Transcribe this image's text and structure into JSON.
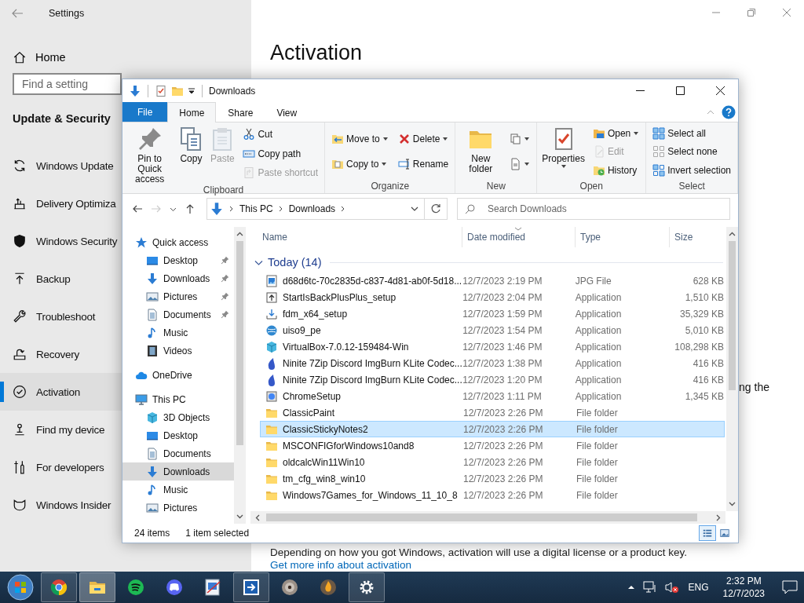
{
  "settings": {
    "title": "Settings",
    "home": "Home",
    "search": {
      "placeholder": "Find a setting"
    },
    "section": "Update & Security",
    "items": [
      {
        "label": "Windows Update",
        "kind": "update",
        "selected": false
      },
      {
        "label": "Delivery Optimiza",
        "kind": "delivery",
        "selected": false
      },
      {
        "label": "Windows Security",
        "kind": "shield",
        "selected": false
      },
      {
        "label": "Backup",
        "kind": "backup",
        "selected": false
      },
      {
        "label": "Troubleshoot",
        "kind": "wrench",
        "selected": false
      },
      {
        "label": "Recovery",
        "kind": "recovery",
        "selected": false
      },
      {
        "label": "Activation",
        "kind": "check",
        "selected": true
      },
      {
        "label": "Find my device",
        "kind": "find",
        "selected": false
      },
      {
        "label": "For developers",
        "kind": "dev",
        "selected": false
      },
      {
        "label": "Windows Insider",
        "kind": "insider",
        "selected": false
      }
    ],
    "page_title": "Activation",
    "fragment": "ng the",
    "description": "Depending on how you got Windows, activation will use a digital license or a product key.",
    "link": "Get more info about activation"
  },
  "explorer": {
    "title": "Downloads",
    "tabs": [
      {
        "label": "File",
        "kind": "menu",
        "selected": false
      },
      {
        "label": "Home",
        "kind": "tab",
        "selected": true
      },
      {
        "label": "Share",
        "kind": "tab",
        "selected": false
      },
      {
        "label": "View",
        "kind": "tab",
        "selected": false
      }
    ],
    "ribbon": [
      {
        "label": "Clipboard",
        "columns": [
          [
            {
              "label": "Pin to Quick access",
              "kind": "pin",
              "disabled": false,
              "dropdown": false
            }
          ],
          [
            {
              "label": "Copy",
              "kind": "copy",
              "disabled": false,
              "dropdown": false
            }
          ],
          [
            {
              "label": "Paste",
              "kind": "paste",
              "disabled": true,
              "dropdown": false
            }
          ],
          [
            {
              "label": "Cut",
              "kind": "cut",
              "disabled": false,
              "dropdown": false
            },
            {
              "label": "Copy path",
              "kind": "copypath",
              "disabled": false,
              "dropdown": false
            },
            {
              "label": "Paste shortcut",
              "kind": "shortcut",
              "disabled": true,
              "dropdown": false
            }
          ]
        ]
      },
      {
        "label": "Organize",
        "columns": [
          [
            {
              "label": "Move to",
              "kind": "move",
              "disabled": false,
              "dropdown": true
            },
            {
              "label": "Copy to",
              "kind": "copyto",
              "disabled": false,
              "dropdown": true
            }
          ],
          [
            {
              "label": "Delete",
              "kind": "delete",
              "disabled": false,
              "dropdown": true
            },
            {
              "label": "Rename",
              "kind": "rename",
              "disabled": false,
              "dropdown": false
            }
          ]
        ]
      },
      {
        "label": "New",
        "columns": [
          [
            {
              "label": "New folder",
              "kind": "folder",
              "disabled": false,
              "dropdown": false
            }
          ],
          [
            {
              "kind": "newitem",
              "disabled": false,
              "dropdown": true
            },
            {
              "kind": "easy",
              "disabled": false,
              "dropdown": true
            }
          ]
        ]
      },
      {
        "label": "Open",
        "columns": [
          [
            {
              "label": "Properties",
              "kind": "doccheck",
              "disabled": false,
              "dropdown": true
            }
          ],
          [
            {
              "label": "Open",
              "kind": "open",
              "disabled": false,
              "dropdown": true
            },
            {
              "label": "Edit",
              "kind": "edit",
              "disabled": true,
              "dropdown": false
            },
            {
              "label": "History",
              "kind": "history",
              "disabled": false,
              "dropdown": false
            }
          ]
        ]
      },
      {
        "label": "Select",
        "columns": [
          [
            {
              "label": "Select all",
              "kind": "selectall",
              "disabled": false,
              "dropdown": false
            },
            {
              "label": "Select none",
              "kind": "selectnone",
              "disabled": false,
              "dropdown": false
            },
            {
              "label": "Invert selection",
              "kind": "invert",
              "disabled": false,
              "dropdown": false
            }
          ]
        ]
      }
    ],
    "path": [
      "This PC",
      "Downloads"
    ],
    "search": {
      "placeholder": "Search Downloads"
    },
    "nav": [
      {
        "label": "Quick access",
        "kind": "star",
        "selected": false,
        "children": [
          {
            "label": "Desktop",
            "kind": "desktop",
            "pinned": true,
            "selected": false
          },
          {
            "label": "Downloads",
            "kind": "down",
            "pinned": true,
            "selected": false
          },
          {
            "label": "Pictures",
            "kind": "pictures",
            "pinned": true,
            "selected": false
          },
          {
            "label": "Documents",
            "kind": "documents",
            "pinned": true,
            "selected": false
          },
          {
            "label": "Music",
            "kind": "music",
            "pinned": false,
            "selected": false
          },
          {
            "label": "Videos",
            "kind": "videos",
            "pinned": false,
            "selected": false
          }
        ]
      },
      {
        "label": "OneDrive",
        "kind": "cloud",
        "selected": false
      },
      {
        "label": "This PC",
        "kind": "pc",
        "selected": false,
        "children": [
          {
            "label": "3D Objects",
            "kind": "cube",
            "pinned": false,
            "selected": false
          },
          {
            "label": "Desktop",
            "kind": "desktop",
            "pinned": false,
            "selected": false
          },
          {
            "label": "Documents",
            "kind": "documents",
            "pinned": false,
            "selected": false
          },
          {
            "label": "Downloads",
            "kind": "down",
            "pinned": false,
            "selected": true
          },
          {
            "label": "Music",
            "kind": "music",
            "pinned": false,
            "selected": false
          },
          {
            "label": "Pictures",
            "kind": "pictures",
            "pinned": false,
            "selected": false
          }
        ]
      }
    ],
    "columns": [
      {
        "label": "Name",
        "sorted": false
      },
      {
        "label": "Date modified",
        "sorted": true
      },
      {
        "label": "Type",
        "sorted": false
      },
      {
        "label": "Size",
        "sorted": false
      }
    ],
    "group": {
      "label": "Today (14)",
      "expanded": true
    },
    "files": [
      {
        "name": "d68d6tc-70c2835d-c837-4d81-ab0f-5d18...",
        "date": "12/7/2023 2:19 PM",
        "type": "JPG File",
        "size": "628 KB",
        "kind": "image",
        "selected": false
      },
      {
        "name": "StartIsBackPlusPlus_setup",
        "date": "12/7/2023 2:04 PM",
        "type": "Application",
        "size": "1,510 KB",
        "kind": "installer",
        "selected": false
      },
      {
        "name": "fdm_x64_setup",
        "date": "12/7/2023 1:59 PM",
        "type": "Application",
        "size": "35,329 KB",
        "kind": "fdm",
        "selected": false
      },
      {
        "name": "uiso9_pe",
        "date": "12/7/2023 1:54 PM",
        "type": "Application",
        "size": "5,010 KB",
        "kind": "globe",
        "selected": false
      },
      {
        "name": "VirtualBox-7.0.12-159484-Win",
        "date": "12/7/2023 1:46 PM",
        "type": "Application",
        "size": "108,298 KB",
        "kind": "cube",
        "selected": false
      },
      {
        "name": "Ninite 7Zip Discord ImgBurn KLite Codec...",
        "date": "12/7/2023 1:38 PM",
        "type": "Application",
        "size": "416 KB",
        "kind": "drop",
        "selected": false
      },
      {
        "name": "Ninite 7Zip Discord ImgBurn KLite Codec...",
        "date": "12/7/2023 1:20 PM",
        "type": "Application",
        "size": "416 KB",
        "kind": "drop",
        "selected": false
      },
      {
        "name": "ChromeSetup",
        "date": "12/7/2023 1:11 PM",
        "type": "Application",
        "size": "1,345 KB",
        "kind": "setup",
        "selected": false
      },
      {
        "name": "ClassicPaint",
        "date": "12/7/2023 2:26 PM",
        "type": "File folder",
        "kind": "folder",
        "selected": false
      },
      {
        "name": "ClassicStickyNotes2",
        "date": "12/7/2023 2:26 PM",
        "type": "File folder",
        "kind": "folder",
        "selected": true
      },
      {
        "name": "MSCONFIGforWindows10and8",
        "date": "12/7/2023 2:26 PM",
        "type": "File folder",
        "kind": "folder",
        "selected": false
      },
      {
        "name": "oldcalcWin11Win10",
        "date": "12/7/2023 2:26 PM",
        "type": "File folder",
        "kind": "folder",
        "selected": false
      },
      {
        "name": "tm_cfg_win8_win10",
        "date": "12/7/2023 2:26 PM",
        "type": "File folder",
        "kind": "folder",
        "selected": false
      },
      {
        "name": "Windows7Games_for_Windows_11_10_8",
        "date": "12/7/2023 2:26 PM",
        "type": "File folder",
        "kind": "folder",
        "selected": false
      }
    ],
    "status": {
      "count": "24 items",
      "selection": "1 item selected"
    },
    "views": [
      {
        "kind": "details",
        "selected": true
      },
      {
        "kind": "large",
        "selected": false
      }
    ]
  },
  "taskbar": {
    "apps": [
      {
        "kind": "browser",
        "open": true,
        "selected": false
      },
      {
        "kind": "explorer",
        "open": true,
        "selected": true
      },
      {
        "kind": "music",
        "open": false,
        "selected": false
      },
      {
        "kind": "chat",
        "open": false,
        "selected": false
      },
      {
        "kind": "paint",
        "open": false,
        "selected": false
      },
      {
        "kind": "arrow",
        "open": true,
        "selected": false
      },
      {
        "kind": "disc",
        "open": false,
        "selected": false
      },
      {
        "kind": "orb",
        "open": false,
        "selected": false
      },
      {
        "kind": "gear",
        "open": true,
        "selected": false
      }
    ],
    "language": "ENG",
    "time": "2:32 PM",
    "date": "12/7/2023"
  }
}
